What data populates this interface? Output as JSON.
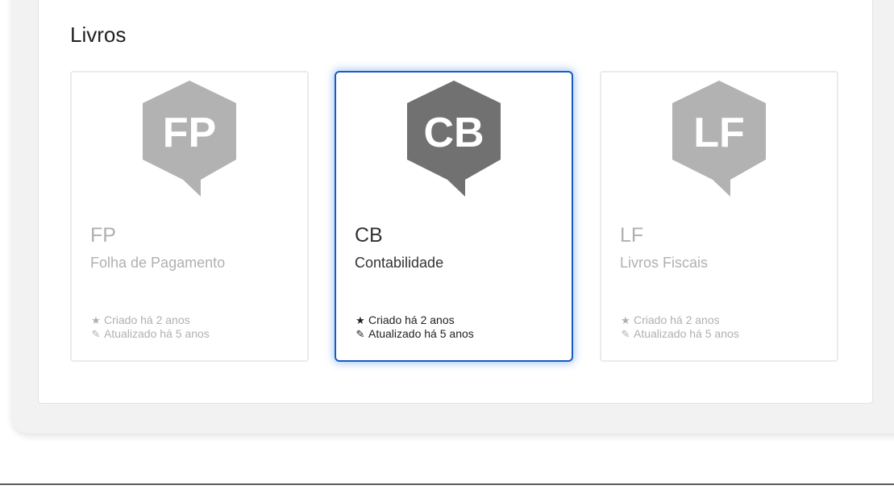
{
  "section": {
    "title": "Livros"
  },
  "cards": [
    {
      "badge_text": "FP",
      "badge_color": "#b2b2b2",
      "code": "FP",
      "name": "Folha de Pagamento",
      "created": "Criado há 2 anos",
      "updated": "Atualizado há 5 anos",
      "selected": false
    },
    {
      "badge_text": "CB",
      "badge_color": "#717171",
      "code": "CB",
      "name": "Contabilidade",
      "created": "Criado há 2 anos",
      "updated": "Atualizado há 5 anos",
      "selected": true
    },
    {
      "badge_text": "LF",
      "badge_color": "#b2b2b2",
      "code": "LF",
      "name": "Livros Fiscais",
      "created": "Criado há 2 anos",
      "updated": "Atualizado há 5 anos",
      "selected": false
    }
  ],
  "icons": {
    "created": "star-icon",
    "updated": "pencil-icon"
  },
  "colors": {
    "selected_border": "#1a5bbf",
    "muted_text": "#b0b0b0"
  }
}
